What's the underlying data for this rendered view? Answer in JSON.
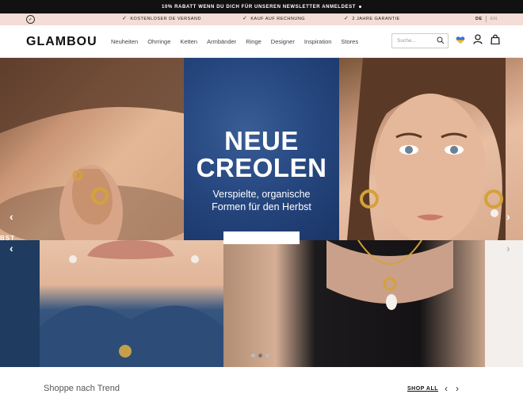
{
  "announcement": {
    "text": "10% RABATT WENN DU DICH FÜR UNSEREN NEWSLETTER ANMELDEST"
  },
  "usp": {
    "items": [
      "KOSTENLOSER DE VERSAND",
      "KAUF AUF RECHNUNG",
      "2 JAHRE GARANTIE"
    ],
    "lang_de": "DE",
    "lang_en": "EN"
  },
  "header": {
    "logo": "GLAMBOU",
    "nav": [
      "Neuheiten",
      "Ohrringe",
      "Ketten",
      "Armbänder",
      "Ringe",
      "Designer",
      "Inspiration",
      "Stores"
    ],
    "search_placeholder": "Suche..."
  },
  "hero": {
    "headline_1": "NEUE",
    "headline_2": "CREOLEN",
    "sub_1": "Verspielte, organische",
    "sub_2": "Formen für den Herbst",
    "side_label": "BST"
  },
  "trend": {
    "title": "Shoppe nach Trend",
    "shop_all": "SHOP ALL"
  },
  "colors": {
    "announce_bg": "#111111",
    "usp_bg": "#f4ddd6",
    "denim": "#25467e"
  }
}
